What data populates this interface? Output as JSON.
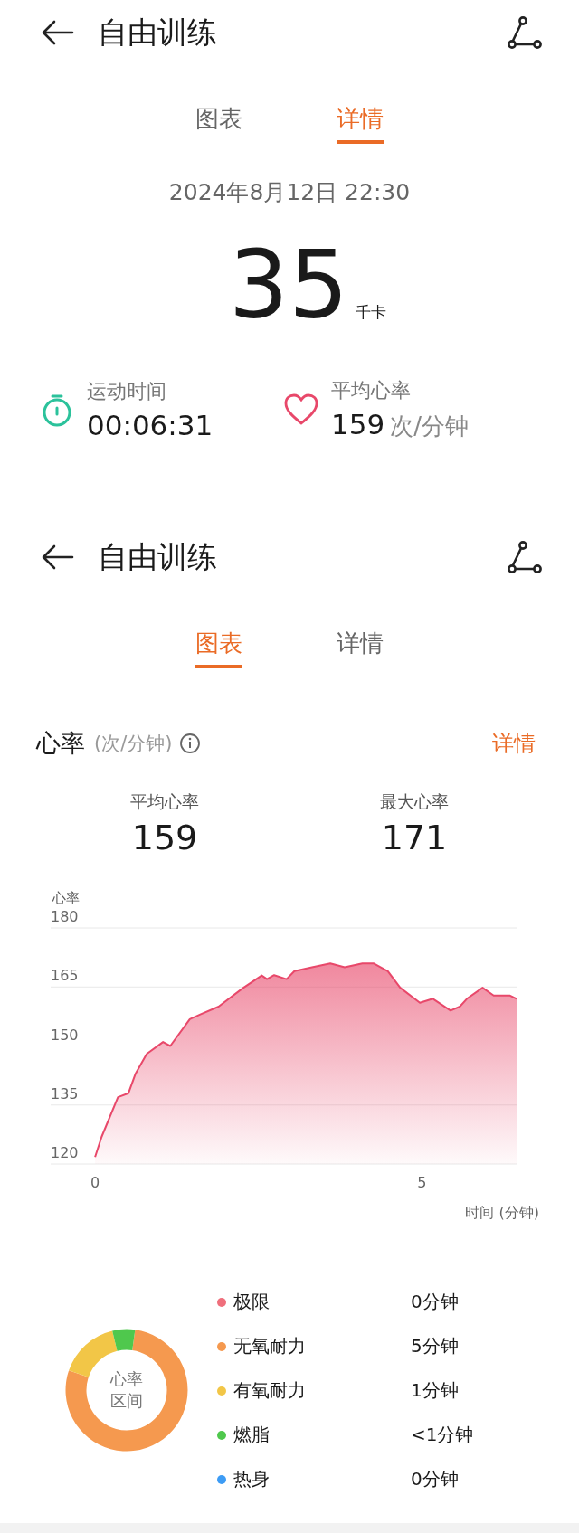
{
  "details_screen": {
    "title": "自由训练",
    "tabs": [
      {
        "label": "图表",
        "selected": false
      },
      {
        "label": "详情",
        "selected": true
      }
    ],
    "date": "2024年8月12日 22:30",
    "calories": "35",
    "calories_unit": "千卡",
    "stats": [
      {
        "kind": "stopwatch",
        "label": "运动时间",
        "value": "00:06:31"
      },
      {
        "kind": "heart",
        "label": "平均心率",
        "value": "159",
        "unit": "次/分钟"
      }
    ]
  },
  "chart_screen": {
    "title": "自由训练",
    "tabs": [
      {
        "label": "图表",
        "selected": true
      },
      {
        "label": "详情",
        "selected": false
      }
    ],
    "section": {
      "title": "心率",
      "unit": "(次/分钟)",
      "link": "详情"
    },
    "stats": [
      {
        "label": "平均心率",
        "value": "159"
      },
      {
        "label": "最大心率",
        "value": "171"
      }
    ],
    "chart_data": {
      "type": "area",
      "ylabel": "心率",
      "xlabel": "时间 (分钟)",
      "grid": true,
      "xlim": [
        -0.68,
        6.45
      ],
      "ylim": [
        120,
        180
      ],
      "xticks": [
        0,
        5
      ],
      "yticks": [
        120,
        135,
        150,
        165,
        180
      ],
      "x": [
        0,
        0.1,
        0.35,
        0.51,
        0.62,
        0.79,
        1.04,
        1.15,
        1.45,
        1.61,
        1.89,
        2.27,
        2.55,
        2.63,
        2.74,
        2.93,
        3.05,
        3.32,
        3.6,
        3.82,
        4.09,
        4.26,
        4.48,
        4.67,
        4.97,
        5.17,
        5.44,
        5.58,
        5.69,
        5.93,
        6.1,
        6.35,
        6.45
      ],
      "series": [
        {
          "color": "#e8486a",
          "values": [
            121.8,
            126.9,
            137,
            138,
            143,
            148,
            151,
            150,
            156.8,
            158,
            160,
            164.8,
            167.9,
            167,
            168,
            167,
            169,
            170,
            171,
            170,
            171,
            171,
            169,
            164.8,
            161,
            162,
            159,
            160,
            162,
            164.8,
            162.8,
            162.8,
            162
          ]
        }
      ]
    },
    "zones_chart": {
      "chart_data": {
        "type": "donut",
        "title": "心率区间",
        "categories": [
          "极限",
          "无氧耐力",
          "有氧耐力",
          "燃脂",
          "热身"
        ],
        "values": [
          0,
          78,
          16,
          6,
          0
        ]
      },
      "zones": [
        {
          "duration": "0分钟",
          "color": "#ef6f7c"
        },
        {
          "duration": "5分钟",
          "color": "#f5994f"
        },
        {
          "duration": "1分钟",
          "color": "#f2c647"
        },
        {
          "duration": "<1分钟",
          "color": "#4fc84d"
        },
        {
          "duration": "0分钟",
          "color": "#3d9cf5"
        }
      ]
    }
  }
}
